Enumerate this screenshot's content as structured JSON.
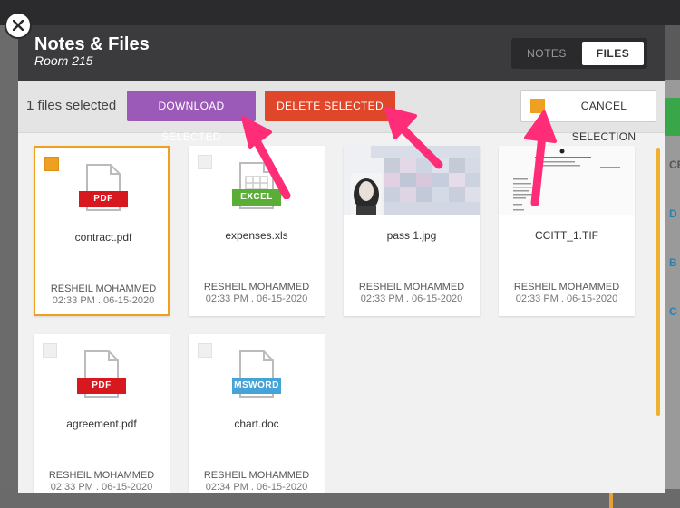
{
  "modal": {
    "title": "Notes & Files",
    "subtitle": "Room 215",
    "tabs": [
      {
        "label": "NOTES",
        "active": false
      },
      {
        "label": "FILES",
        "active": true
      }
    ]
  },
  "action_bar": {
    "selected_count": "1 files selected",
    "download_label": "DOWNLOAD SELECTED",
    "delete_label": "DELETE SELECTED",
    "cancel_label": "CANCEL SELECTION"
  },
  "files": [
    {
      "name": "contract.pdf",
      "type": "PDF",
      "owner": "RESHEIL MOHAMMED",
      "timestamp": "02:33 PM . 06-15-2020",
      "selected": true
    },
    {
      "name": "expenses.xls",
      "type": "EXCEL",
      "owner": "RESHEIL MOHAMMED",
      "timestamp": "02:33 PM . 06-15-2020",
      "selected": false
    },
    {
      "name": "pass 1.jpg",
      "type": "image",
      "owner": "RESHEIL MOHAMMED",
      "timestamp": "02:33 PM . 06-15-2020",
      "selected": false
    },
    {
      "name": "CCITT_1.TIF",
      "type": "image",
      "owner": "RESHEIL MOHAMMED",
      "timestamp": "02:33 PM . 06-15-2020",
      "selected": false
    },
    {
      "name": "agreement.pdf",
      "type": "PDF",
      "owner": "RESHEIL MOHAMMED",
      "timestamp": "02:33 PM . 06-15-2020",
      "selected": false
    },
    {
      "name": "chart.doc",
      "type": "MSWORD",
      "owner": "RESHEIL MOHAMMED",
      "timestamp": "02:34 PM . 06-15-2020",
      "selected": false
    }
  ],
  "background": {
    "right_letters": [
      "CE",
      "D",
      "B",
      "C"
    ]
  },
  "colors": {
    "accent": "#f0a020",
    "download": "#9b5ab8",
    "delete": "#e0462a",
    "arrow": "#ff2d78",
    "header": "#3b3b3e"
  }
}
